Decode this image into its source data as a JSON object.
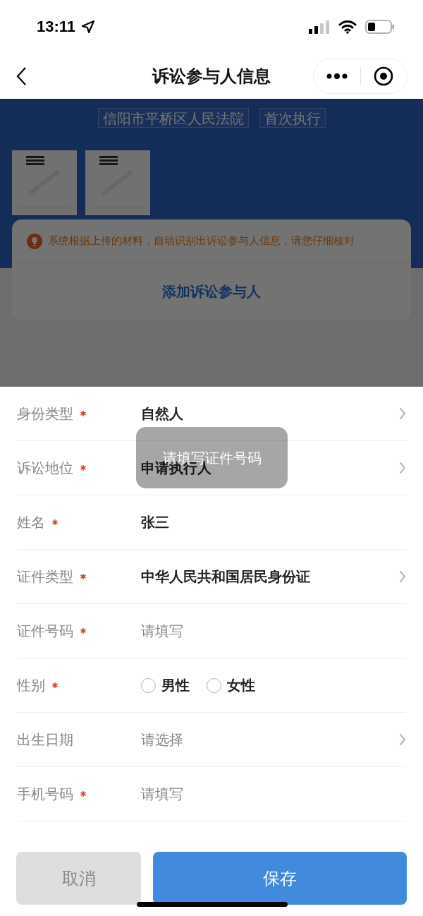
{
  "status_bar": {
    "time": "13:11"
  },
  "nav": {
    "title": "诉讼参与人信息"
  },
  "case_tags": [
    "信阳市平桥区人民法院",
    "首次执行"
  ],
  "notice": "系统根据上传的材料，自动识别出诉讼参与人信息，请您仔细核对",
  "add_button": "添加诉讼参与人",
  "form": [
    {
      "kind": "select",
      "label": "身份类型",
      "required": true,
      "value": "自然人"
    },
    {
      "kind": "select",
      "label": "诉讼地位",
      "required": true,
      "value": "申请执行人"
    },
    {
      "kind": "text",
      "label": "姓名",
      "required": true,
      "value": "张三"
    },
    {
      "kind": "select",
      "label": "证件类型",
      "required": true,
      "value": "中华人民共和国居民身份证"
    },
    {
      "kind": "input",
      "label": "证件号码",
      "required": true,
      "placeholder": "请填写"
    },
    {
      "kind": "radio",
      "label": "性别",
      "required": true,
      "options": [
        {
          "label": "男性",
          "selected": false
        },
        {
          "label": "女性",
          "selected": false
        }
      ]
    },
    {
      "kind": "select",
      "label": "出生日期",
      "required": false,
      "placeholder": "请选择"
    },
    {
      "kind": "input",
      "label": "手机号码",
      "required": true,
      "placeholder": "请填写"
    }
  ],
  "toast": "请填写证件号码",
  "buttons": {
    "cancel": "取消",
    "save": "保存"
  }
}
